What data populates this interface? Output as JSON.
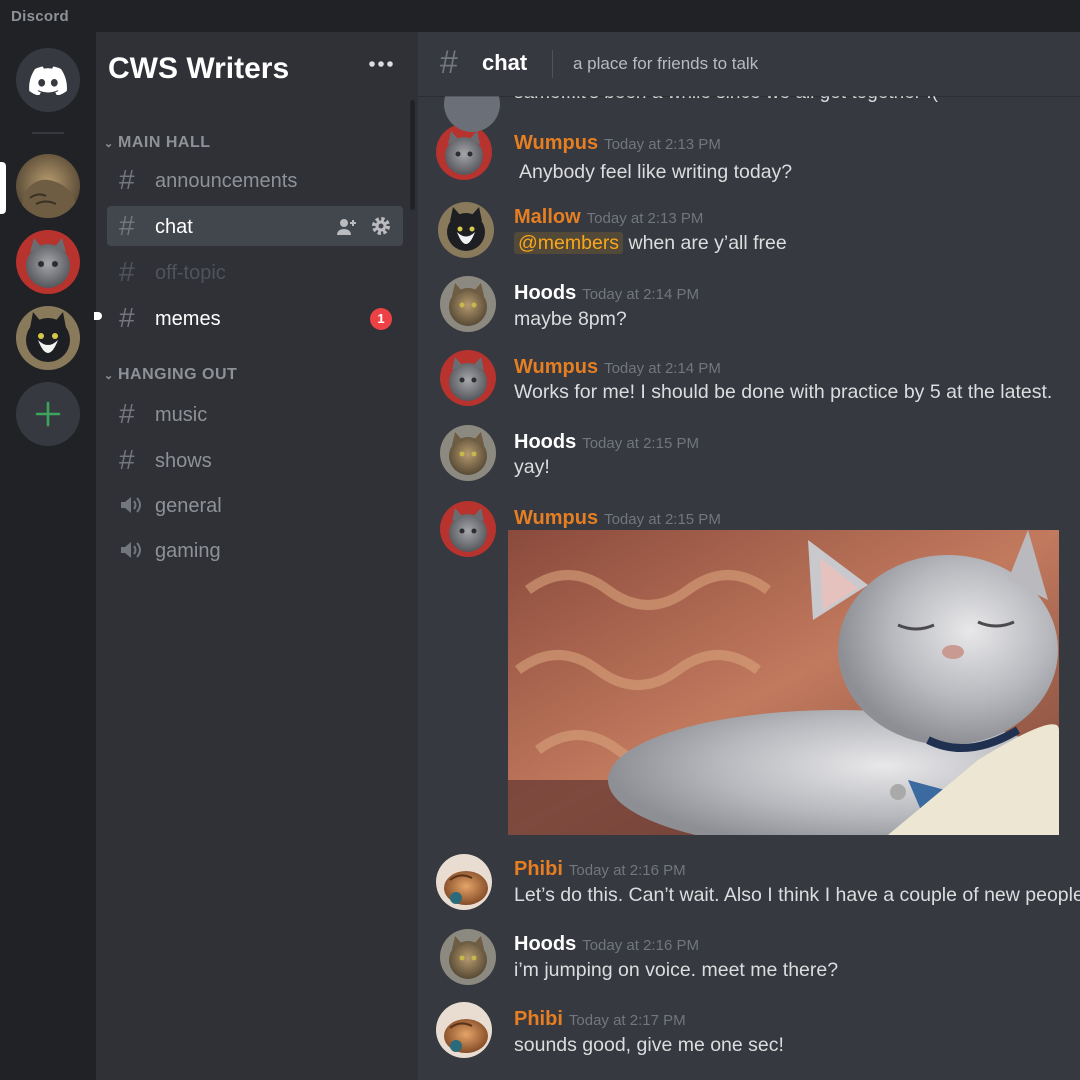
{
  "app": {
    "name": "Discord"
  },
  "colors": {
    "accent_author": "#e67e22",
    "mention": "#faa61a",
    "badge": "#ed4245",
    "add_server": "#3ba55d"
  },
  "server": {
    "name": "CWS Writers",
    "menu_icon": "more-dots-icon"
  },
  "categories": [
    {
      "name": "MAIN HALL",
      "channels": [
        {
          "name": "announcements",
          "type": "text"
        },
        {
          "name": "chat",
          "type": "text",
          "selected": true
        },
        {
          "name": "off-topic",
          "type": "text",
          "muted": true
        },
        {
          "name": "memes",
          "type": "text",
          "unread": true,
          "badge": "1"
        }
      ]
    },
    {
      "name": "HANGING OUT",
      "channels": [
        {
          "name": "music",
          "type": "text"
        },
        {
          "name": "shows",
          "type": "text"
        },
        {
          "name": "general",
          "type": "voice"
        },
        {
          "name": "gaming",
          "type": "voice"
        }
      ]
    }
  ],
  "channel": {
    "name": "chat",
    "topic": "a place for friends to talk"
  },
  "messages": {
    "cutoff": "same...it's been a while since we all got together :(",
    "items": [
      {
        "author": "Wumpus",
        "time": "Today at 2:13 PM",
        "text": "Anybody feel like writing today?"
      },
      {
        "author": "Mallow",
        "time": "Today at 2:13 PM",
        "mention": "@members",
        "text": "when are y’all free"
      },
      {
        "author": "Hoods",
        "time": "Today at 2:14 PM",
        "text": "maybe 8pm?"
      },
      {
        "author": "Wumpus",
        "time": "Today at 2:14 PM",
        "text": "Works for me! I should be done with practice by 5 at the latest."
      },
      {
        "author": "Hoods",
        "time": "Today at 2:15 PM",
        "text": "yay!"
      },
      {
        "author": "Wumpus",
        "time": "Today at 2:15 PM",
        "attachment": "sleepy-cat-image"
      },
      {
        "author": "Phibi",
        "time": "Today at 2:16 PM",
        "text": "Let’s do this. Can’t wait. Also I think I have a couple of new people"
      },
      {
        "author": "Hoods",
        "time": "Today at 2:16 PM",
        "text": "i’m jumping on voice. meet me there?"
      },
      {
        "author": "Phibi",
        "time": "Today at 2:17 PM",
        "text": "sounds good, give me one sec!"
      }
    ]
  }
}
